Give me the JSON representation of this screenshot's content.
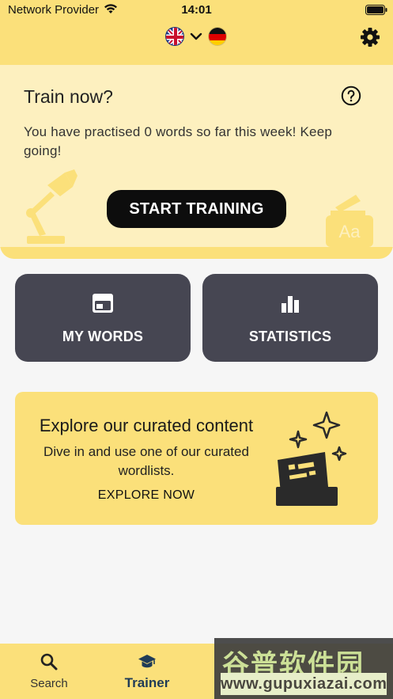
{
  "status_bar": {
    "carrier": "Network Provider",
    "time": "14:01"
  },
  "header": {
    "source_language_icon": "uk-flag-icon",
    "target_language_icon": "german-flag-icon",
    "settings_icon": "gear-icon"
  },
  "train_card": {
    "title": "Train now?",
    "message": "You have practised 0 words so far this week! Keep going!",
    "button_label": "START TRAINING"
  },
  "tiles": {
    "my_words": "MY WORDS",
    "statistics": "STATISTICS"
  },
  "explore": {
    "title": "Explore our curated content",
    "text": "Dive in and use one of our curated wordlists.",
    "link": "EXPLORE NOW"
  },
  "tab_bar": {
    "search_label": "Search",
    "trainer_label": "Trainer"
  },
  "watermark": {
    "text": "谷普软件园",
    "url": "www.gupuxiazai.com"
  },
  "colors": {
    "header_yellow": "#fbe07a",
    "card_cream": "#fdf0bf",
    "tile_dark": "#464652",
    "active_tab": "#1f3b57"
  }
}
